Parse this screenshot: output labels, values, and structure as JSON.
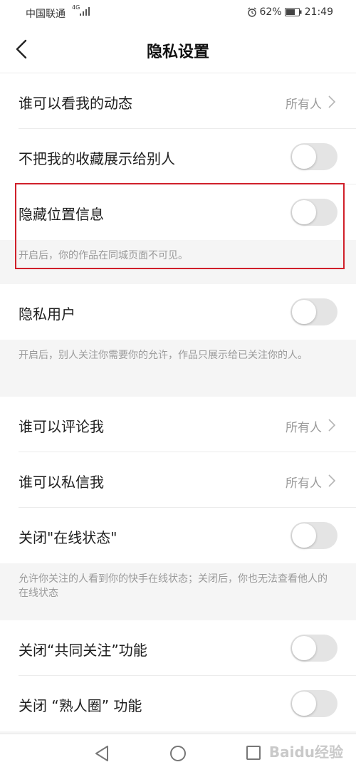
{
  "status_bar": {
    "carrier": "中国联通",
    "network": "4G",
    "battery_percent": "62%",
    "time": "21:49"
  },
  "nav": {
    "title": "隐私设置"
  },
  "rows": [
    {
      "label": "谁可以看我的动态",
      "value": "所有人",
      "kind": "link"
    },
    {
      "label": "不把我的收藏展示给别人",
      "kind": "toggle",
      "on": false
    },
    {
      "label": "隐藏位置信息",
      "kind": "toggle",
      "on": false
    },
    {
      "label": "隐私用户",
      "kind": "toggle",
      "on": false
    },
    {
      "label": "谁可以评论我",
      "value": "所有人",
      "kind": "link"
    },
    {
      "label": "谁可以私信我",
      "value": "所有人",
      "kind": "link"
    },
    {
      "label": "关闭\"在线状态\"",
      "kind": "toggle",
      "on": false
    },
    {
      "label": "关闭“共同关注”功能",
      "kind": "toggle",
      "on": false
    },
    {
      "label": "关闭 “熟人圈” 功能",
      "kind": "toggle",
      "on": false
    }
  ],
  "notes": {
    "location": "开启后，你的作品在同城页面不可见。",
    "private_user": "开启后，别人关注你需要你的允许，作品只展示给已关注你的人。",
    "online_status": "允许你关注的人看到你的快手在线状态；关闭后，你也无法查看他人的在线状态"
  },
  "watermark": "Baidu经验",
  "colors": {
    "highlight": "#d0202a",
    "toggle_off": "#e4e4e4",
    "value_text": "#9b9b9b"
  }
}
